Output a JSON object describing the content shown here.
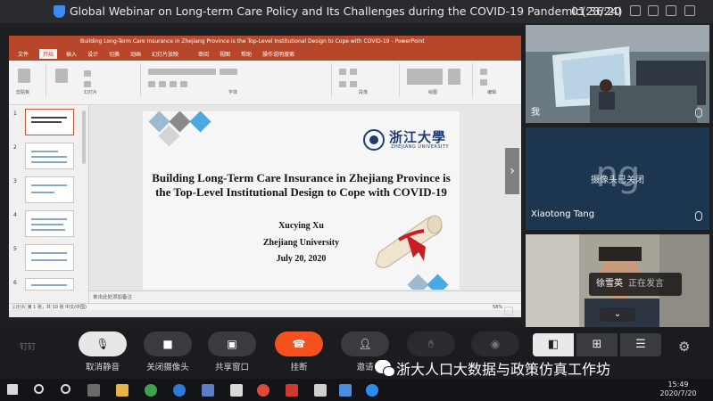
{
  "window": {
    "title": "Global Webinar on Long-term Care Policy and Its Challenges during the COVID-19 Pandemic(23/24)",
    "time": "01:36:20"
  },
  "ppt": {
    "window_title": "Building Long-Term Care Insurance in Zhejiang Province is the Top-Level Institutional Design to Cope with COVID-19 - PowerPoint",
    "tabs": [
      "文件",
      "开始",
      "插入",
      "设计",
      "切换",
      "动画",
      "幻灯片放映",
      "审阅",
      "视图",
      "帮助",
      "操作说明搜索"
    ],
    "active_tab_index": 1,
    "ribbon_groups": [
      "剪贴板",
      "幻灯片",
      "字体",
      "段落",
      "绘图",
      "编辑"
    ],
    "notes_placeholder": "单击此处添加备注",
    "status": "幻灯片 第 1 张，共 10 张   中文(中国)",
    "zoom": "58%",
    "thumb_numbers": [
      "1",
      "2",
      "3",
      "4",
      "5",
      "6"
    ]
  },
  "slide": {
    "university_cn": "浙江大學",
    "university_en": "ZHEJIANG UNIVERSITY",
    "title": "Building Long-Term Care Insurance in Zhejiang Province is the Top-Level Institutional Design to Cope with COVID-19",
    "author": "Xucying Xu",
    "affiliation": "Zhejiang University",
    "date": "July 20, 2020"
  },
  "shared_screen": {
    "page_label": "第2页"
  },
  "participants": [
    {
      "name": "我",
      "state": "video"
    },
    {
      "name": "Xiaotong Tang",
      "state": "camera_off",
      "avatar_text": "ng",
      "status_text": "摄像头已关闭"
    },
    {
      "name": "徐雪英",
      "state": "video",
      "badge_status": "正在发言"
    }
  ],
  "toolbar": {
    "app_name": "钉钉",
    "buttons": [
      {
        "label": "取消静音",
        "icon": "mic-off-icon"
      },
      {
        "label": "关闭摄像头",
        "icon": "camera-icon"
      },
      {
        "label": "共享窗口",
        "icon": "share-screen-icon"
      },
      {
        "label": "挂断",
        "icon": "hangup-icon"
      },
      {
        "label": "邀请",
        "icon": "invite-icon"
      }
    ],
    "watermark": "浙大人口大数据与政策仿真工作坊"
  },
  "taskbar": {
    "clock_time": "15:49",
    "clock_date": "2020/7/20"
  },
  "colors": {
    "ppt_accent": "#b7472a",
    "hangup": "#f4511e",
    "camera_off_tile": "#1d364f"
  }
}
